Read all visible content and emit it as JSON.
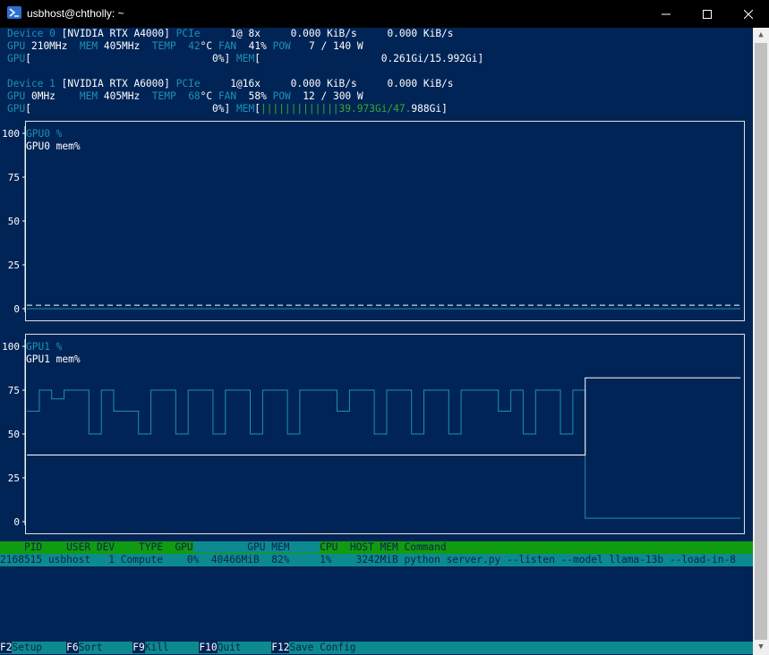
{
  "window": {
    "title": "usbhost@chtholly: ~",
    "minimize_icon": "minimize-icon",
    "maximize_icon": "maximize-icon",
    "close_icon": "close-icon"
  },
  "devices": [
    {
      "label": "Device 0",
      "name": "[NVIDIA RTX A4000]",
      "pcie_label": "PCIe",
      "pcie": "1@ 8x",
      "rx": "0.000 KiB/s",
      "tx": "0.000 KiB/s",
      "gpu_label": "GPU",
      "gpu_clock": "210MHz",
      "mem_label": "MEM",
      "mem_clock": "405MHz",
      "temp_label": "TEMP",
      "temp": "42",
      "temp_unit": "°C",
      "fan_label": "FAN",
      "fan": "41%",
      "pow_label": "POW",
      "pow": "7 / 140 W",
      "util": "0%",
      "mem_used": "",
      "mem_total": "0.261Gi/15.992Gi"
    },
    {
      "label": "Device 1",
      "name": "[NVIDIA RTX A6000]",
      "pcie_label": "PCIe",
      "pcie": "1@16x",
      "rx": "0.000 KiB/s",
      "tx": "0.000 KiB/s",
      "gpu_label": "GPU",
      "gpu_clock": "0MHz",
      "mem_label": "MEM",
      "mem_clock": "405MHz",
      "temp_label": "TEMP",
      "temp": "68",
      "temp_unit": "°C",
      "fan_label": "FAN",
      "fan": "58%",
      "pow_label": "POW",
      "pow": "12 / 300 W",
      "util": "0%",
      "mem_bar": "|||||||||||||",
      "mem_used_text": "39.973Gi/47.",
      "mem_total_rest": "988Gi"
    }
  ],
  "labels": {
    "gpu_bracket": "GPU[",
    "mem_bracket": "MEM[",
    "close_bracket": "]"
  },
  "chart_data": [
    {
      "type": "line",
      "yticks": [
        0,
        25,
        50,
        75,
        100
      ],
      "ylim": [
        0,
        100
      ],
      "series": [
        {
          "name": "GPU0 %",
          "values": [
            0,
            0,
            0,
            0,
            0,
            0,
            0,
            0,
            0,
            0,
            0,
            0,
            0,
            0,
            0,
            0,
            0,
            0,
            0,
            0,
            0,
            0,
            0,
            0,
            0,
            0,
            0,
            0,
            0,
            0,
            0,
            0,
            0,
            0,
            0,
            0,
            0,
            0,
            0,
            0,
            0,
            0,
            0,
            0,
            0,
            0,
            0,
            0,
            0,
            0,
            0,
            0,
            0,
            0,
            0,
            0,
            0,
            0,
            0,
            0,
            0,
            0,
            0,
            0,
            0,
            0,
            0,
            0,
            0,
            0,
            0,
            0,
            0,
            0,
            0,
            0,
            0,
            0,
            0,
            0,
            0,
            0,
            0,
            0,
            0,
            0,
            0,
            0,
            0,
            0,
            0,
            0,
            0,
            0,
            0,
            0,
            0,
            0,
            0,
            0,
            0,
            0,
            0,
            0,
            0,
            0,
            0,
            0,
            0,
            0,
            0,
            0,
            0,
            0,
            0
          ],
          "color": "#1e90b4"
        },
        {
          "name": "GPU0 mem%",
          "values": [
            2,
            2,
            2,
            2,
            2,
            2,
            2,
            2,
            2,
            2,
            2,
            2,
            2,
            2,
            2,
            2,
            2,
            2,
            2,
            2,
            2,
            2,
            2,
            2,
            2,
            2,
            2,
            2,
            2,
            2,
            2,
            2,
            2,
            2,
            2,
            2,
            2,
            2,
            2,
            2,
            2,
            2,
            2,
            2,
            2,
            2,
            2,
            2,
            2,
            2,
            2,
            2,
            2,
            2,
            2,
            2,
            2,
            2,
            2,
            2,
            2,
            2,
            2,
            2,
            2,
            2,
            2,
            2,
            2,
            2,
            2,
            2,
            2,
            2,
            2,
            2,
            2,
            2,
            2,
            2,
            2,
            2,
            2,
            2,
            2,
            2,
            2,
            2,
            2,
            2,
            2,
            2,
            2,
            2,
            2,
            2,
            2,
            2,
            2,
            2,
            2,
            2,
            2,
            2,
            2,
            2,
            2,
            2,
            2,
            2,
            2,
            2,
            2,
            2,
            2
          ],
          "color": "#ffffff"
        }
      ]
    },
    {
      "type": "line",
      "yticks": [
        0,
        25,
        50,
        75,
        100
      ],
      "ylim": [
        0,
        100
      ],
      "series": [
        {
          "name": "GPU1 %",
          "values": [
            63,
            63,
            75,
            75,
            70,
            70,
            75,
            75,
            75,
            75,
            50,
            50,
            75,
            75,
            63,
            63,
            63,
            63,
            50,
            50,
            75,
            75,
            75,
            75,
            50,
            50,
            75,
            75,
            75,
            75,
            50,
            50,
            75,
            75,
            75,
            75,
            50,
            50,
            75,
            75,
            75,
            75,
            50,
            50,
            75,
            75,
            75,
            75,
            75,
            75,
            63,
            63,
            75,
            75,
            75,
            75,
            50,
            50,
            75,
            75,
            75,
            75,
            50,
            50,
            75,
            75,
            75,
            75,
            50,
            50,
            75,
            75,
            75,
            75,
            75,
            75,
            63,
            63,
            75,
            75,
            50,
            50,
            75,
            75,
            75,
            75,
            50,
            50,
            75,
            75,
            2,
            2,
            2,
            2,
            2,
            2,
            2,
            2,
            2,
            2,
            2,
            2,
            2,
            2,
            2,
            2,
            2,
            2,
            2,
            2,
            2,
            2,
            2,
            2,
            2
          ],
          "color": "#1e90b4"
        },
        {
          "name": "GPU1 mem%",
          "values": [
            38,
            38,
            38,
            38,
            38,
            38,
            38,
            38,
            38,
            38,
            38,
            38,
            38,
            38,
            38,
            38,
            38,
            38,
            38,
            38,
            38,
            38,
            38,
            38,
            38,
            38,
            38,
            38,
            38,
            38,
            38,
            38,
            38,
            38,
            38,
            38,
            38,
            38,
            38,
            38,
            38,
            38,
            38,
            38,
            38,
            38,
            38,
            38,
            38,
            38,
            38,
            38,
            38,
            38,
            38,
            38,
            38,
            38,
            38,
            38,
            38,
            38,
            38,
            38,
            38,
            38,
            38,
            38,
            38,
            38,
            38,
            38,
            38,
            38,
            38,
            38,
            38,
            38,
            38,
            38,
            38,
            38,
            38,
            38,
            38,
            38,
            38,
            38,
            38,
            38,
            82,
            82,
            82,
            82,
            82,
            82,
            82,
            82,
            82,
            82,
            82,
            82,
            82,
            82,
            82,
            82,
            82,
            82,
            82,
            82,
            82,
            82,
            82,
            82,
            82
          ],
          "color": "#ffffff"
        }
      ]
    }
  ],
  "process_table": {
    "header": {
      "pid": "PID",
      "user": "USER",
      "dev": "DEV",
      "type": "TYPE",
      "gpu": "GPU",
      "gpu_mem": "GPU MEM",
      "cpu": "CPU",
      "host_mem": "HOST MEM",
      "command": "Command"
    },
    "rows": [
      {
        "pid": "2168515",
        "user": "usbhost",
        "dev": "1",
        "type": "Compute",
        "gpu": "0%",
        "gpu_mem": "40466MiB",
        "gpu_mem_pct": "82%",
        "cpu": "1%",
        "host_mem": "3242MiB",
        "command": "python server.py --listen --model llama-13b --load-in-8"
      }
    ]
  },
  "function_keys": [
    {
      "key": "F2",
      "label": "Setup"
    },
    {
      "key": "F6",
      "label": "Sort"
    },
    {
      "key": "F9",
      "label": "Kill"
    },
    {
      "key": "F10",
      "label": "Quit"
    },
    {
      "key": "F12",
      "label": "Save Config"
    }
  ]
}
